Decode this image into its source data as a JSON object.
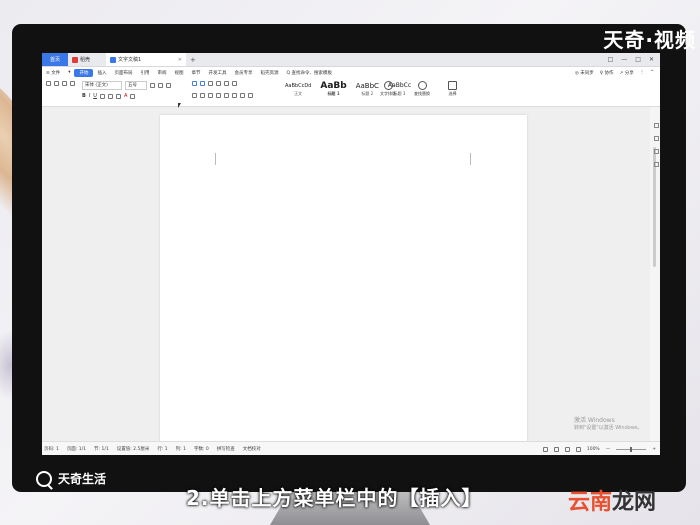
{
  "overlay": {
    "brand": "天奇·视频",
    "logo_bottom": "天奇生活",
    "subtitle": "2.单击上方菜单栏中的【插入】",
    "watermark_main": "云南",
    "watermark_tail": "龙网"
  },
  "titlebar": {
    "tabs": [
      {
        "label": "首页"
      },
      {
        "label": "稻壳"
      },
      {
        "label": "文字文稿1"
      }
    ],
    "add": "+",
    "controls": [
      "□",
      "—",
      "□",
      "✕"
    ]
  },
  "menubar": {
    "items": [
      "≡ 文件",
      "▾",
      "开始",
      "插入",
      "页面布局",
      "引用",
      "审阅",
      "视图",
      "章节",
      "开发工具",
      "会员专享",
      "稻壳资源"
    ],
    "search": "Q 查找命令、搜索模板",
    "right": [
      "◎ 未同步",
      "♀ 协作",
      "↗ 分享",
      "⋮",
      "^"
    ]
  },
  "ribbon": {
    "font_name": "宋体 (正文)",
    "font_size": "五号",
    "styles": [
      {
        "sample": "AaBbCcDd",
        "label": "正文"
      },
      {
        "sample": "AaBb",
        "label": "标题 1"
      },
      {
        "sample": "AaBbC",
        "label": "标题 2"
      },
      {
        "sample": "AaBbCc",
        "label": "标题 3"
      }
    ],
    "buttons": [
      "文字排版",
      "查找替换",
      "选择"
    ]
  },
  "statusbar": {
    "items": [
      "页码: 1",
      "页面: 1/1",
      "节: 1/1",
      "设置值: 2.5厘米",
      "行: 1",
      "列: 1",
      "字数: 0",
      "拼写检查",
      "文档校对"
    ],
    "zoom": "100%"
  },
  "activation": {
    "line1": "激活 Windows",
    "line2": "转到\"设置\"以激活 Windows。"
  }
}
